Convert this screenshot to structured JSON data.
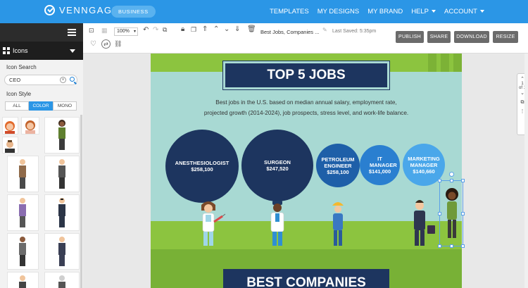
{
  "nav": {
    "brand": "VENNGAGE",
    "badge": "BUSINESS",
    "links": [
      "TEMPLATES",
      "MY DESIGNS",
      "MY BRAND",
      "HELP",
      "ACCOUNT"
    ]
  },
  "sidebar": {
    "category": "Icons",
    "search_label": "Icon Search",
    "search_value": "CEO",
    "style_label": "Icon Style",
    "styles": [
      "ALL",
      "COLOR",
      "MONO"
    ],
    "active_style": "COLOR"
  },
  "toolbar": {
    "zoom": "100%",
    "doc_title": "Best Jobs, Companies ...",
    "last_saved": "Last Saved: 5:35pm",
    "buttons": [
      "PUBLISH",
      "SHARE",
      "DOWNLOAD",
      "RESIZE"
    ]
  },
  "infographic": {
    "title": "TOP 5 JOBS",
    "description_line1": "Best jobs in the U.S. based on median annual salary, employment rate,",
    "description_line2": "projected growth (2014-2024), job prospects, stress level, and work-life balance.",
    "jobs": [
      {
        "title": "ANESTHESIOLOGIST",
        "salary": "$258,100",
        "color": "#1d355f"
      },
      {
        "title": "SURGEON",
        "salary": "$247,520",
        "color": "#1d355f"
      },
      {
        "title": "PETROLEUM ENGINEER",
        "salary": "$258,100",
        "color": "#1e5fa8"
      },
      {
        "title": "IT MANAGER",
        "salary": "$141,000",
        "color": "#2a7fd0"
      },
      {
        "title": "MARKETING MANAGER",
        "salary": "$140,660",
        "color": "#4aa7ea"
      }
    ],
    "section2_title": "BEST COMPANIES"
  },
  "page_indicator": {
    "current": "1",
    "total": "of 1"
  },
  "colors": {
    "accent": "#2b96e6",
    "navy": "#1d355f",
    "teal": "#a8d9d3",
    "grass": "#8cc43f"
  }
}
